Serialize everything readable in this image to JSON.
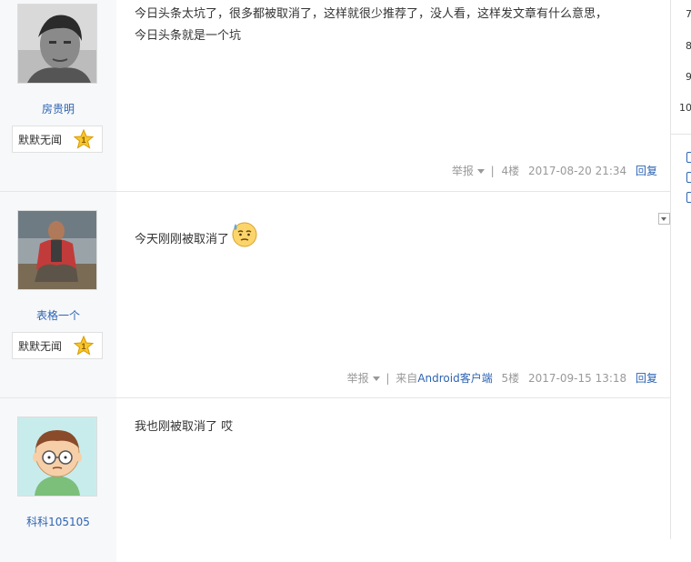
{
  "posts": [
    {
      "username": "房贵明",
      "badge": "默默无闻",
      "badge_level": "1",
      "content_lines": [
        "今日头条太坑了，很多都被取消了，这样就很少推荐了，没人看，这样发文章有什么意思，",
        "今日头条就是一个坑"
      ],
      "report": "举报",
      "source": "",
      "floor": "4楼",
      "time": "2017-08-20 21:34",
      "reply": "回复"
    },
    {
      "username": "表格一个",
      "badge": "默默无闻",
      "badge_level": "1",
      "content_lines": [
        "今天刚刚被取消了"
      ],
      "report": "举报",
      "source_prefix": "来自",
      "source": "Android客户端",
      "floor": "5楼",
      "time": "2017-09-15 13:18",
      "reply": "回复"
    },
    {
      "username": "科科105105",
      "content_lines": [
        "我也刚被取消了 哎"
      ]
    }
  ],
  "right_column": {
    "numbers": [
      "7",
      "8",
      "9",
      "10"
    ]
  },
  "colors": {
    "link": "#2d64b3",
    "sidebar_bg": "#f7f8fa",
    "meta_text": "#999999"
  }
}
